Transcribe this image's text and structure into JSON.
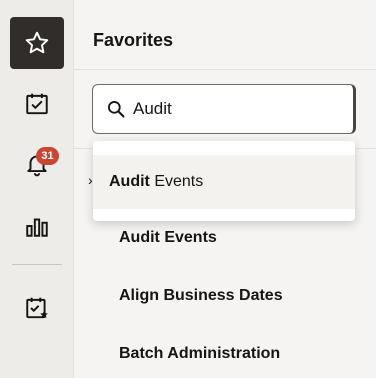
{
  "rail": {
    "items": [
      {
        "icon": "star-icon",
        "active": true
      },
      {
        "icon": "task-check-icon",
        "active": false
      },
      {
        "icon": "bell-icon",
        "active": false,
        "badge": "31"
      },
      {
        "icon": "bar-chart-icon",
        "active": false
      },
      {
        "icon": "starred-task-icon",
        "active": false
      }
    ]
  },
  "panel": {
    "title": "Favorites",
    "search": {
      "value": "Audit",
      "placeholder": ""
    },
    "suggestion": {
      "match": "Audit",
      "rest": " Events"
    },
    "items": [
      {
        "label": "Audit Events"
      },
      {
        "label": "Align Business Dates"
      },
      {
        "label": "Batch Administration"
      }
    ]
  },
  "colors": {
    "active_rail": "#312d2a",
    "badge": "#c74634",
    "panel_bg": "#f5f4f2",
    "rail_bg": "#eeece9"
  }
}
